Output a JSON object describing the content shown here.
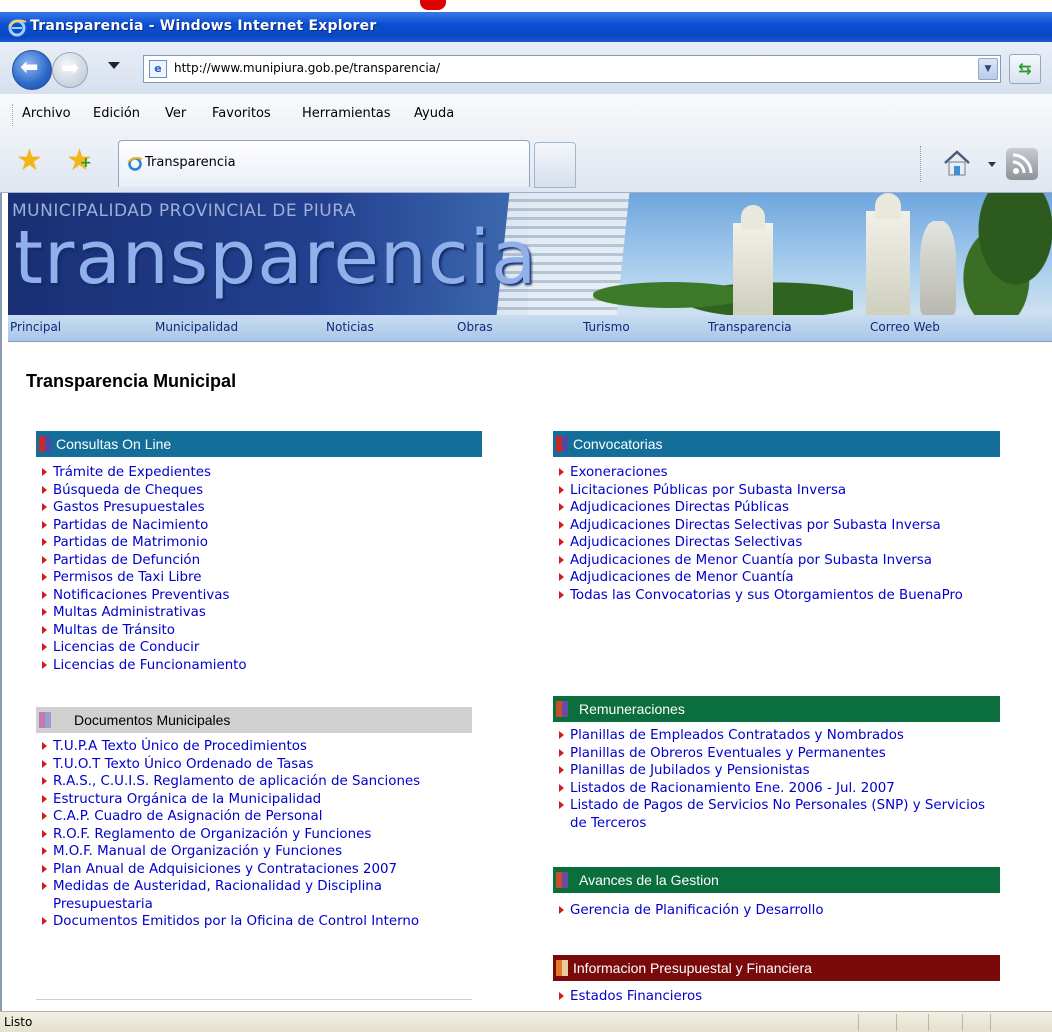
{
  "window": {
    "title": "Transparencia - Windows Internet Explorer"
  },
  "address": {
    "url": "http://www.munipiura.gob.pe/transparencia/"
  },
  "menu": [
    "Archivo",
    "Edición",
    "Ver",
    "Favoritos",
    "Herramientas",
    "Ayuda"
  ],
  "tab": {
    "title": "Transparencia"
  },
  "banner": {
    "subtitle": "MUNICIPALIDAD PROVINCIAL DE PIURA",
    "title": "transparencia"
  },
  "sitenav": [
    "Principal",
    "Municipalidad",
    "Noticias",
    "Obras",
    "Turismo",
    "Transparencia",
    "Correo Web"
  ],
  "page": {
    "heading": "Transparencia Municipal"
  },
  "sections": {
    "consultas": {
      "title": "Consultas On Line",
      "items": [
        "Trámite de Expedientes",
        "Búsqueda de Cheques",
        "Gastos Presupuestales",
        "Partidas de Nacimiento",
        "Partidas de Matrimonio",
        "Partidas de Defunción",
        "Permisos de Taxi Libre",
        "Notificaciones Preventivas",
        "Multas Administrativas",
        "Multas de Tránsito",
        "Licencias de Conducir",
        "Licencias de Funcionamiento"
      ]
    },
    "documentos": {
      "title": "Documentos Municipales",
      "items": [
        "T.U.P.A Texto Único de Procedimientos",
        "T.U.O.T Texto Único Ordenado de Tasas",
        "R.A.S., C.U.I.S. Reglamento de aplicación de Sanciones",
        "Estructura Orgánica de la Municipalidad",
        "C.A.P. Cuadro de Asignación de Personal",
        "R.O.F. Reglamento de Organización y Funciones",
        "M.O.F. Manual de Organización y Funciones",
        "Plan Anual de Adquisiciones y Contrataciones 2007",
        "Medidas de Austeridad, Racionalidad y Disciplina Presupuestaria",
        "Documentos Emitidos por la Oficina de Control Interno"
      ]
    },
    "convocatorias": {
      "title": "Convocatorias",
      "items": [
        "Exoneraciones",
        "Licitaciones Públicas por Subasta Inversa",
        "Adjudicaciones Directas Públicas",
        "Adjudicaciones Directas Selectivas por Subasta Inversa",
        "Adjudicaciones Directas Selectivas",
        "Adjudicaciones de Menor Cuantía por Subasta Inversa",
        "Adjudicaciones de Menor Cuantía",
        "Todas las Convocatorias y sus Otorgamientos de BuenaPro"
      ]
    },
    "remuneraciones": {
      "title": "Remuneraciones",
      "items": [
        "Planillas de Empleados Contratados y Nombrados",
        "Planillas de Obreros Eventuales y Permanentes",
        "Planillas de Jubilados y Pensionistas",
        "Listados de Racionamiento Ene. 2006 - Jul. 2007",
        "Listado de Pagos de Servicios No Personales (SNP) y Servicios de Terceros"
      ]
    },
    "avances": {
      "title": "Avances de la Gestion",
      "items": [
        "Gerencia de Planificación y Desarrollo"
      ]
    },
    "informacion": {
      "title": "Informacion Presupuestal y Financiera",
      "items": [
        "Estados Financieros"
      ]
    }
  },
  "status": {
    "text": "Listo"
  },
  "colors": {
    "header_blue": "#136f99",
    "header_green": "#0a6e3d",
    "header_maroon": "#7a0a0a",
    "link": "#0000cc",
    "bullet": "#d21c1c"
  }
}
